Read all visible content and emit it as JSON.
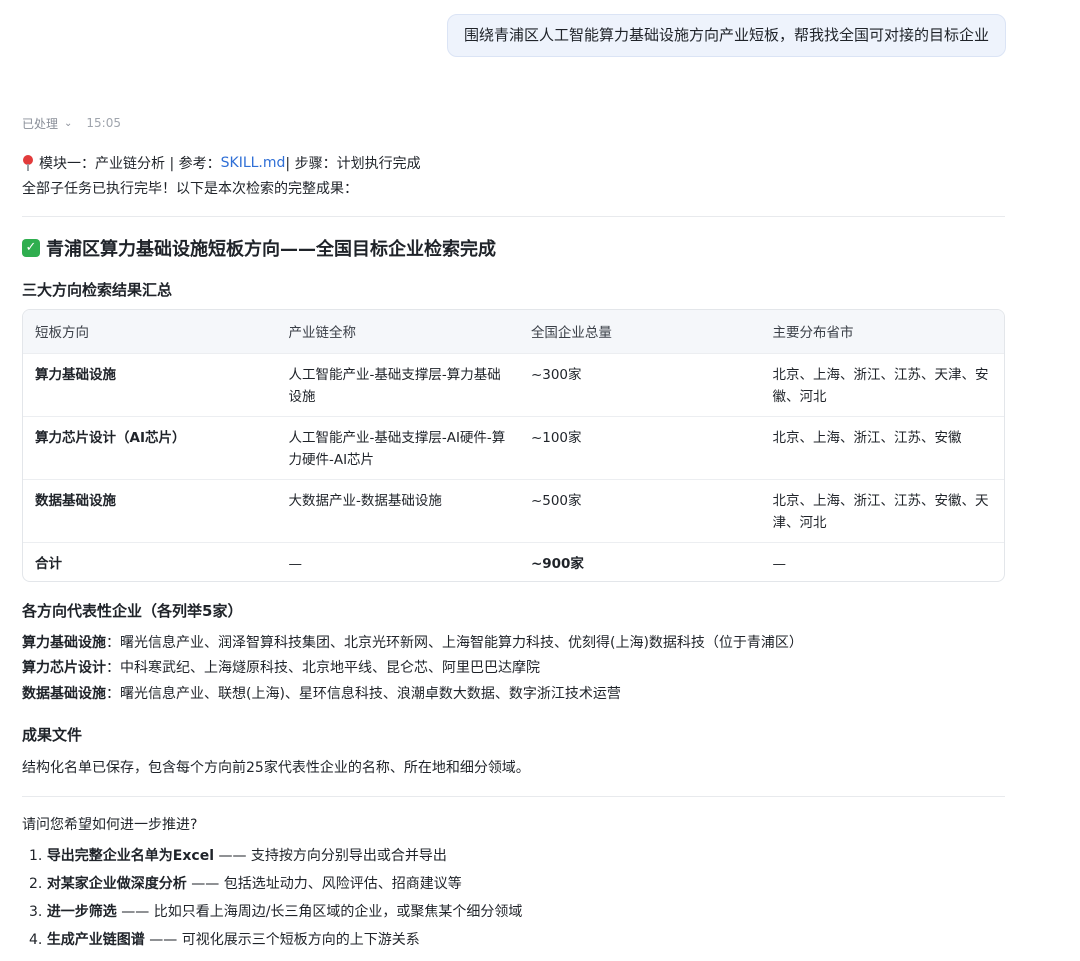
{
  "user_message": "围绕青浦区人工智能算力基础设施方向产业短板，帮我找全国可对接的目标企业",
  "status": {
    "label": "已处理",
    "time": "15:05"
  },
  "meta": {
    "prefix": "模块一：产业链分析 | 参考：",
    "link": "SKILL.md",
    "suffix": " | 步骤：计划执行完成"
  },
  "intro": "全部子任务已执行完毕！以下是本次检索的完整成果：",
  "heading": "青浦区算力基础设施短板方向——全国目标企业检索完成",
  "summary_title": "三大方向检索结果汇总",
  "table": {
    "headers": [
      "短板方向",
      "产业链全称",
      "全国企业总量",
      "主要分布省市"
    ],
    "rows": [
      [
        "算力基础设施",
        "人工智能产业-基础支撑层-算力基础设施",
        "~300家",
        "北京、上海、浙江、江苏、天津、安徽、河北"
      ],
      [
        "算力芯片设计（AI芯片）",
        "人工智能产业-基础支撑层-AI硬件-算力硬件-AI芯片",
        "~100家",
        "北京、上海、浙江、江苏、安徽"
      ],
      [
        "数据基础设施",
        "大数据产业-数据基础设施",
        "~500家",
        "北京、上海、浙江、江苏、安徽、天津、河北"
      ],
      [
        "合计",
        "—",
        "~900家",
        "—"
      ]
    ]
  },
  "rep_title": "各方向代表性企业（各列举5家）",
  "reps": [
    {
      "label": "算力基础设施",
      "text": "：曙光信息产业、润泽智算科技集团、北京光环新网、上海智能算力科技、优刻得(上海)数据科技（位于青浦区）"
    },
    {
      "label": "算力芯片设计",
      "text": "：中科寒武纪、上海燧原科技、北京地平线、昆仑芯、阿里巴巴达摩院"
    },
    {
      "label": "数据基础设施",
      "text": "：曙光信息产业、联想(上海)、星环信息科技、浪潮卓数大数据、数字浙江技术运营"
    }
  ],
  "files_title": "成果文件",
  "files_text": "结构化名单已保存，包含每个方向前25家代表性企业的名称、所在地和细分领域。",
  "question": "请问您希望如何进一步推进?",
  "options": [
    {
      "num": "1.",
      "bold": "导出完整企业名单为Excel",
      "rest": " —— 支持按方向分别导出或合并导出"
    },
    {
      "num": "2.",
      "bold": "对某家企业做深度分析",
      "rest": " —— 包括选址动力、风险评估、招商建议等"
    },
    {
      "num": "3.",
      "bold": "进一步筛选",
      "rest": " —— 比如只看上海周边/长三角区域的企业，或聚焦某个细分领域"
    },
    {
      "num": "4.",
      "bold": "生成产业链图谱",
      "rest": " —— 可视化展示三个短板方向的上下游关系"
    }
  ]
}
